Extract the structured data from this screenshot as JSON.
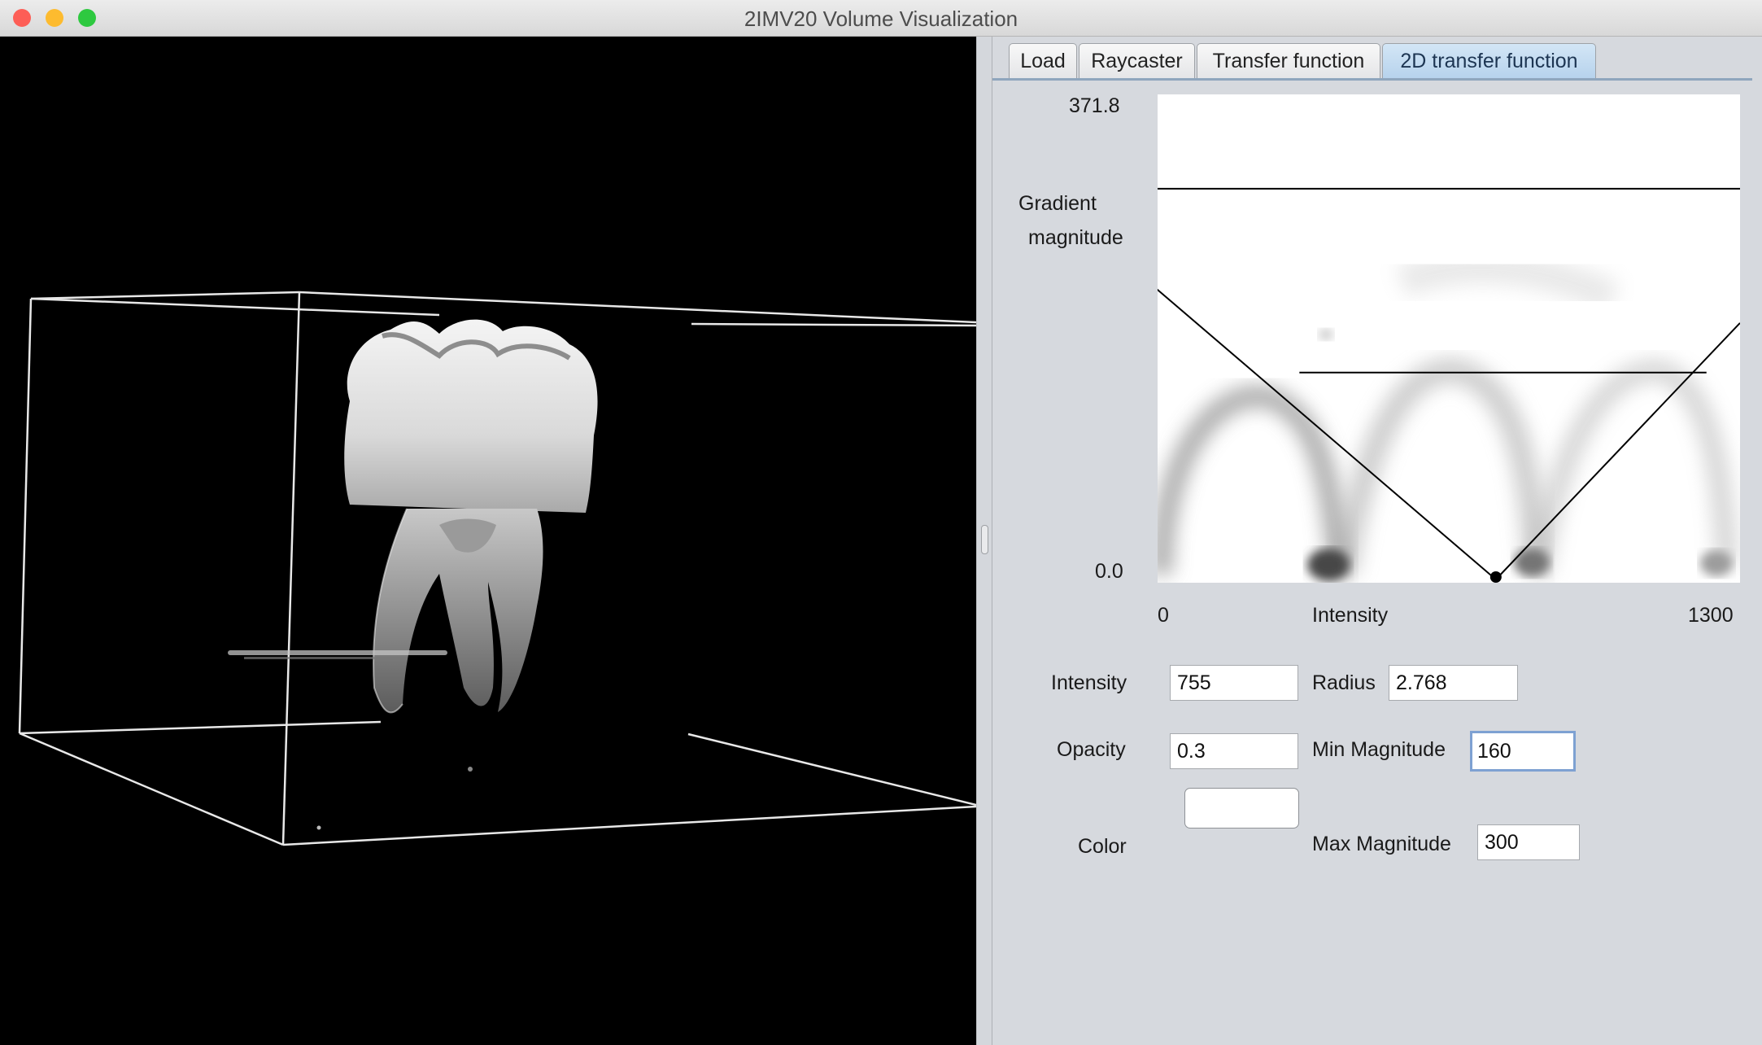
{
  "window": {
    "title": "2IMV20 Volume Visualization",
    "traffic_lights": {
      "close": "#fd5e56",
      "minimize": "#fdbb2f",
      "maximize": "#2ec940"
    }
  },
  "tabs": [
    {
      "label": "Load",
      "active": false
    },
    {
      "label": "Raycaster",
      "active": false
    },
    {
      "label": "Transfer function",
      "active": false
    },
    {
      "label": "2D transfer function",
      "active": true
    }
  ],
  "plot": {
    "y_max_label": "371.8",
    "y_min_label": "0.0",
    "y_axis_label_line1": "Gradient",
    "y_axis_label_line2": "magnitude",
    "x_min_label": "0",
    "x_axis_label": "Intensity",
    "x_max_label": "1300",
    "x_min": 0,
    "x_max": 1300,
    "y_min": 0,
    "y_max": 371.8,
    "triangle": {
      "intensity": 755,
      "radius": 2.768,
      "min_magnitude": 160,
      "max_magnitude": 300
    }
  },
  "controls": {
    "intensity_label": "Intensity",
    "intensity_value": "755",
    "radius_label": "Radius",
    "radius_value": "2.768",
    "opacity_label": "Opacity",
    "opacity_value": "0.3",
    "min_magnitude_label": "Min Magnitude",
    "min_magnitude_value": "160",
    "color_label": "Color",
    "color_value": "#ffffff",
    "max_magnitude_label": "Max Magnitude",
    "max_magnitude_value": "300"
  }
}
